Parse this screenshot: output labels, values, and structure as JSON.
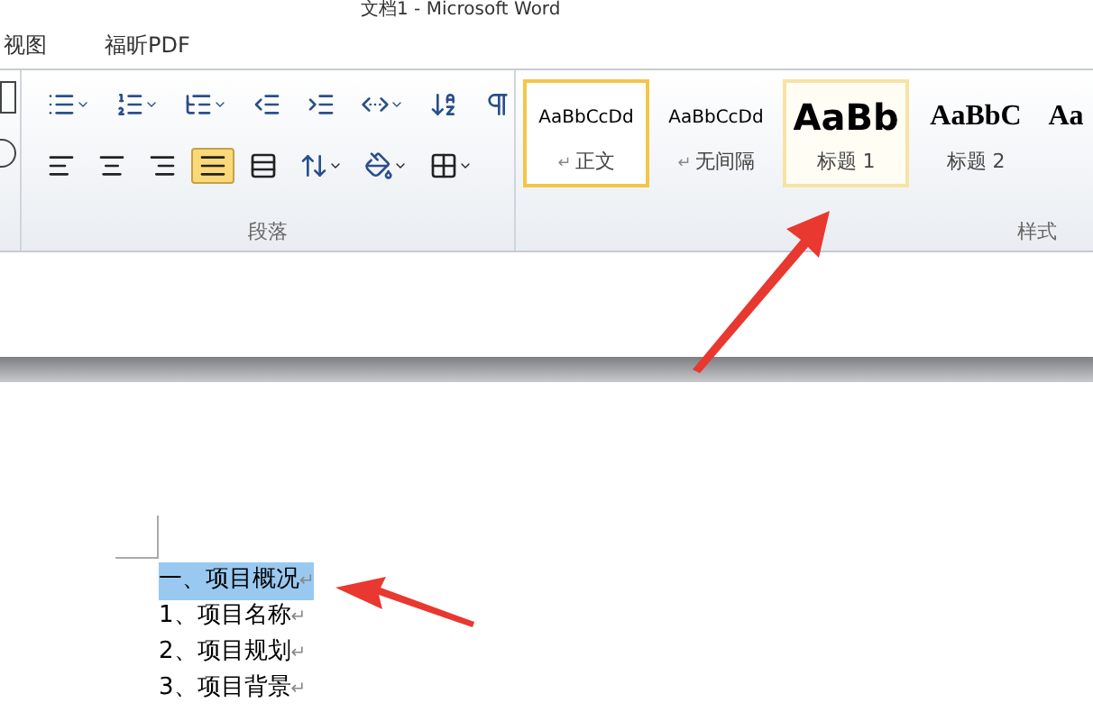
{
  "window": {
    "title": "文档1 - Microsoft Word"
  },
  "tabs": [
    {
      "label": "视图",
      "selected": false
    },
    {
      "label": "福昕PDF",
      "selected": false
    }
  ],
  "paragraph_group": {
    "label": "段落",
    "align_buttons": [
      {
        "selected": false
      },
      {
        "selected": false
      },
      {
        "selected": false
      },
      {
        "selected": true
      },
      {
        "selected": false
      }
    ]
  },
  "styles_group": {
    "label": "样式",
    "styles": [
      {
        "preview": "AaBbCcDd",
        "mark": "↵",
        "name": "正文",
        "kind": "body",
        "selected": true,
        "hovered": false
      },
      {
        "preview": "AaBbCcDd",
        "mark": "↵",
        "name": "无间隔",
        "kind": "body",
        "selected": false,
        "hovered": false
      },
      {
        "preview": "AaBb",
        "name": "标题 1",
        "kind": "heading1",
        "selected": false,
        "hovered": true
      },
      {
        "preview": "AaBbC",
        "name": "标题 2",
        "kind": "heading2",
        "selected": false,
        "hovered": false
      },
      {
        "preview": "Aa",
        "kind": "heading2",
        "selected": false,
        "hovered": false
      }
    ]
  },
  "document": {
    "paragraphs": [
      {
        "text": "一、项目概况",
        "mark": "↵",
        "selected": true
      },
      {
        "text": "1、项目名称",
        "mark": "↵",
        "selected": false
      },
      {
        "text": "2、项目规划",
        "mark": "↵",
        "selected": false
      },
      {
        "text": "3、项目背景",
        "mark": "↵",
        "selected": false
      }
    ]
  }
}
